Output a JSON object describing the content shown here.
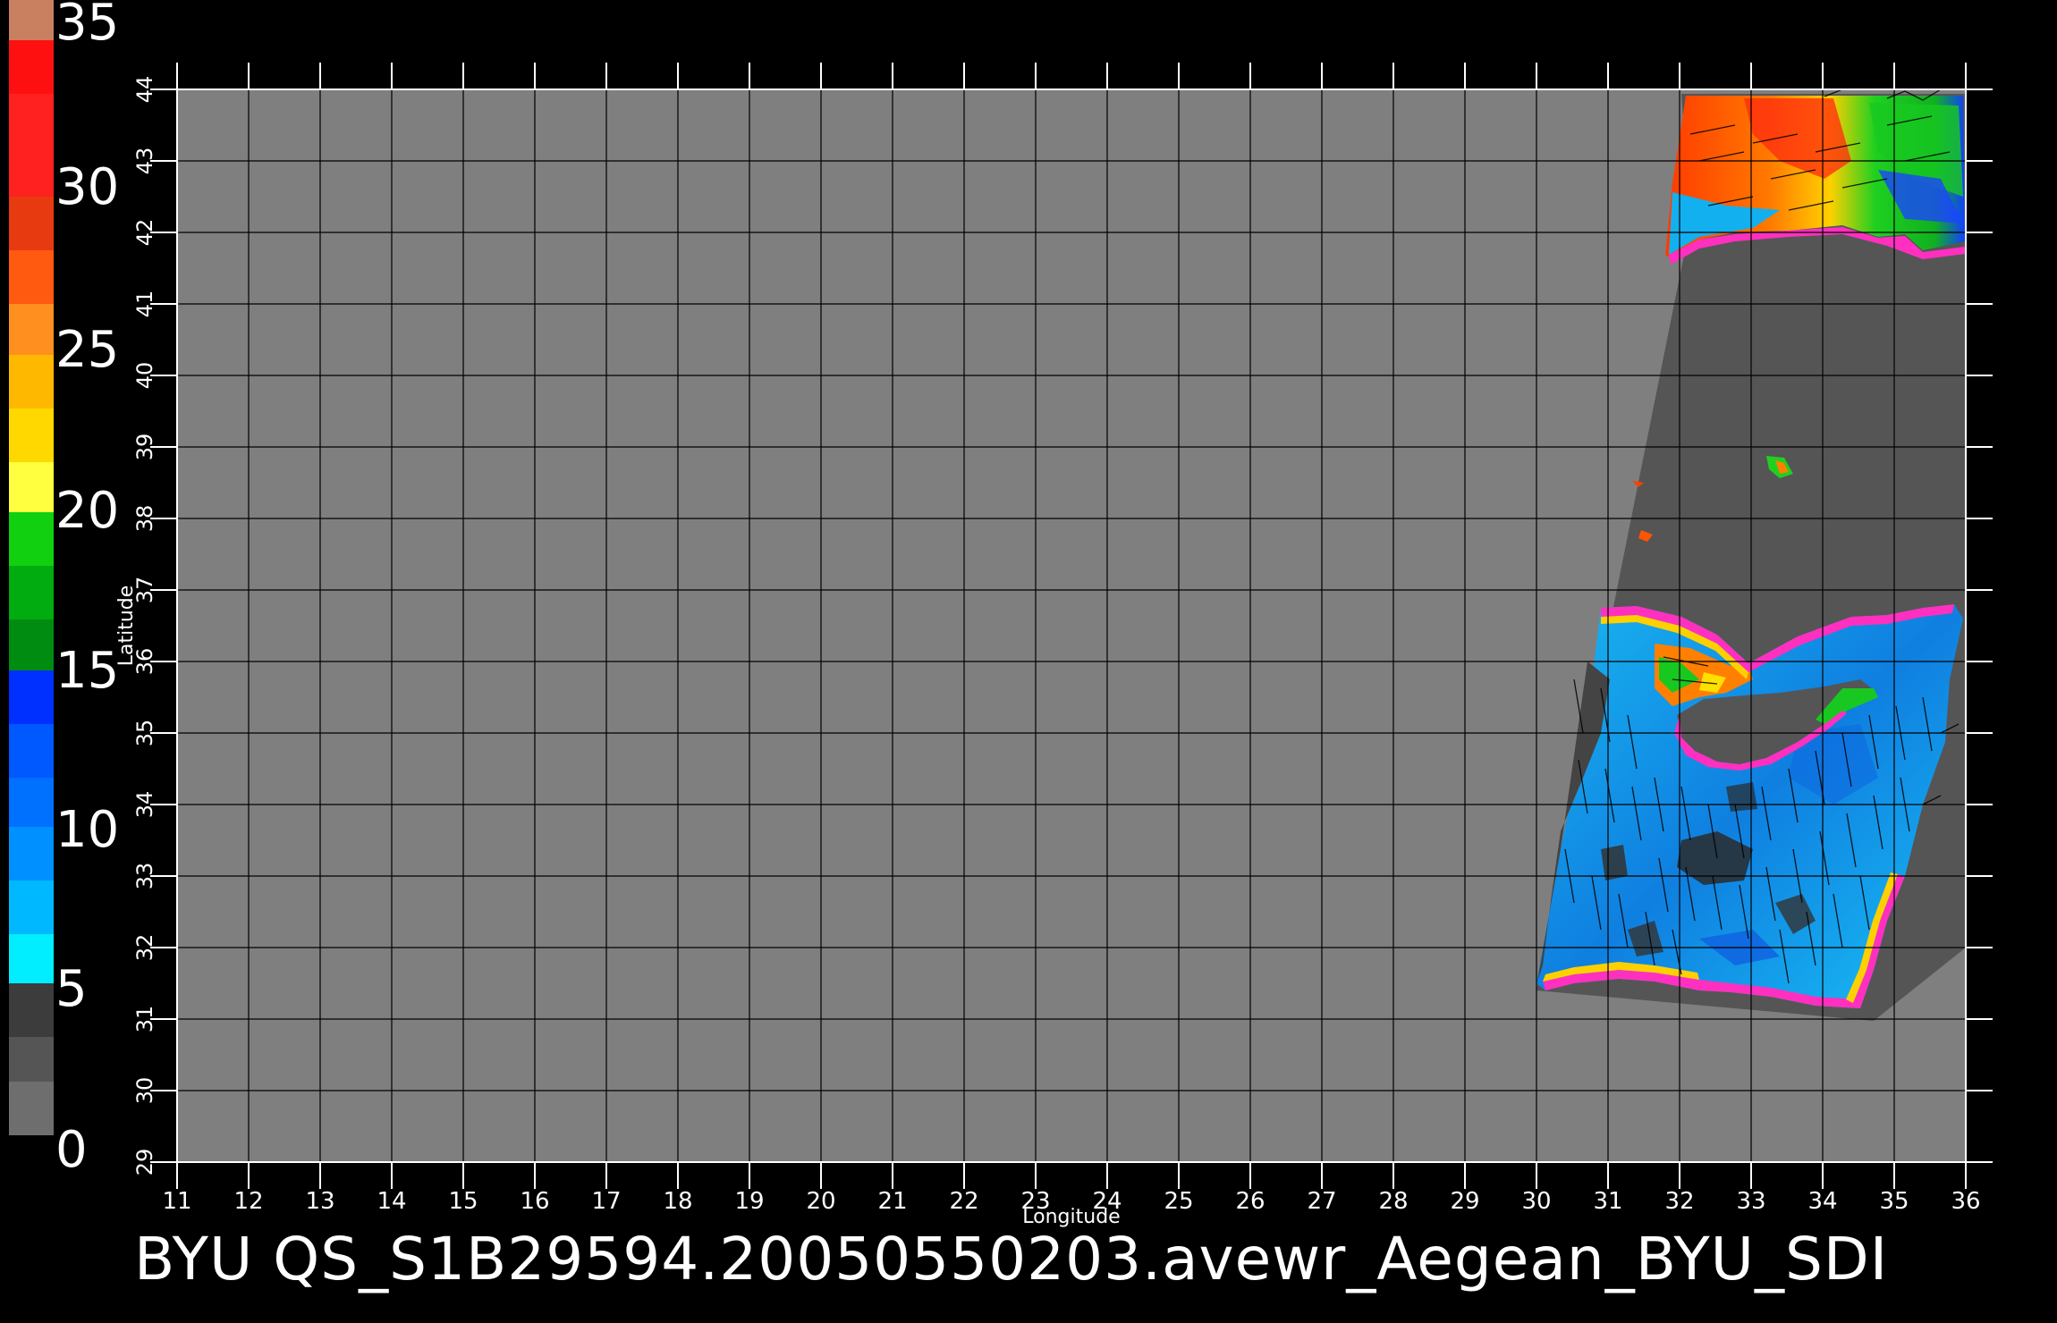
{
  "colorbar": {
    "ticks": [
      "0",
      "5",
      "10",
      "15",
      "20",
      "25",
      "30",
      "35"
    ]
  },
  "axes": {
    "xlabel": "Longitude",
    "ylabel": "Latitude",
    "x_ticks": [
      "11",
      "12",
      "13",
      "14",
      "15",
      "16",
      "17",
      "18",
      "19",
      "20",
      "21",
      "22",
      "23",
      "24",
      "25",
      "26",
      "27",
      "28",
      "29",
      "30",
      "31",
      "32",
      "33",
      "34",
      "35",
      "36"
    ],
    "y_ticks": [
      "29",
      "30",
      "31",
      "32",
      "33",
      "34",
      "35",
      "36",
      "37",
      "38",
      "39",
      "40",
      "41",
      "42",
      "43",
      "44"
    ],
    "xlim": [
      11,
      36
    ],
    "ylim": [
      29,
      44
    ]
  },
  "colors": {
    "background": "#000000",
    "land": "#7f7f7f",
    "swath_calm": "#555555",
    "grid": "#000000",
    "frame": "#ffffff"
  },
  "caption": "BYU  QS_S1B29594.20050550203.avewr_Aegean_BYU_SDI"
}
